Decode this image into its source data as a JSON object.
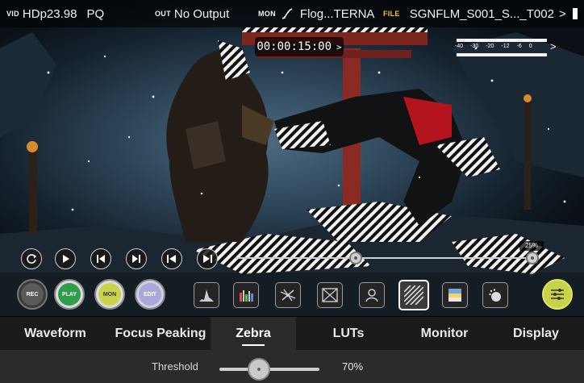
{
  "status_bar": {
    "vid_tag": "VID",
    "input_format": "HDp23.98",
    "transfer": "PQ",
    "out_tag": "OUT",
    "output": "No Output",
    "mon_tag": "MON",
    "mon_curve_icon": "log-curve-icon",
    "mon_lut": "Flog...TERNA",
    "file_tag": "FILE",
    "file_name": "SGNFLM_S001_S..._T002",
    "file_chevron": ">"
  },
  "overlay": {
    "timecode": "00:00:15:00",
    "timecode_chevron": ">",
    "audio_scale": [
      "-40",
      "-30",
      "-20",
      "-12",
      "-6",
      "0"
    ],
    "audio_chevron": ">"
  },
  "playback": {
    "scrub_position": 0.4,
    "volume_percent": 25,
    "volume_label": "25%"
  },
  "mode_buttons": [
    {
      "label": "REC",
      "color": "#5a5a5a"
    },
    {
      "label": "PLAY",
      "color": "#2e9e4b"
    },
    {
      "label": "MON",
      "color": "#c9d34a"
    },
    {
      "label": "EDIT",
      "color": "#a9a9d9"
    }
  ],
  "tabs": [
    {
      "label": "Waveform"
    },
    {
      "label": "Focus Peaking"
    },
    {
      "label": "Zebra",
      "active": true
    },
    {
      "label": "LUTs"
    },
    {
      "label": "Monitor"
    },
    {
      "label": "Display"
    }
  ],
  "zebra": {
    "threshold_label": "Threshold",
    "threshold_value": "70%",
    "threshold_fraction": 0.7
  },
  "colors": {
    "file_tag": "#f0c21b",
    "accent_green": "#2e9e4b",
    "accent_yellow": "#c9d34a"
  }
}
